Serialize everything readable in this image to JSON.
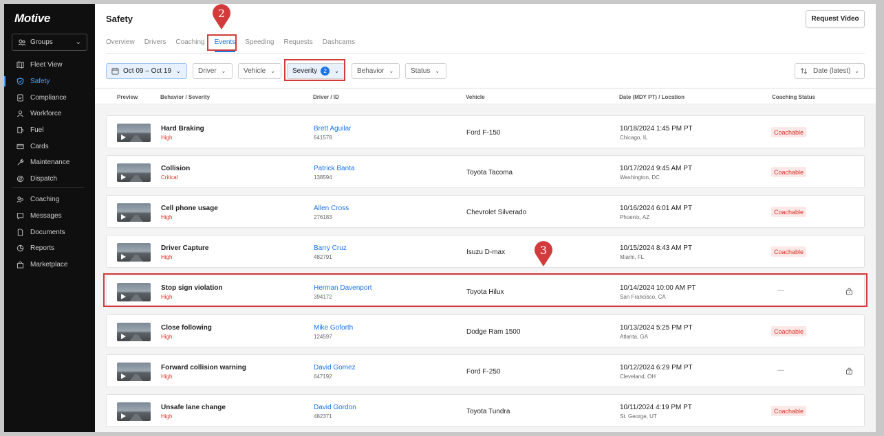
{
  "app": {
    "logo": "Motive",
    "groups_label": "Groups"
  },
  "nav": [
    {
      "label": "Fleet View",
      "icon": "map-icon"
    },
    {
      "label": "Safety",
      "icon": "shield-icon",
      "active": true
    },
    {
      "label": "Compliance",
      "icon": "compliance-icon"
    },
    {
      "label": "Workforce",
      "icon": "workforce-icon"
    },
    {
      "label": "Fuel",
      "icon": "fuel-icon"
    },
    {
      "label": "Cards",
      "icon": "card-icon"
    },
    {
      "label": "Maintenance",
      "icon": "wrench-icon"
    },
    {
      "label": "Dispatch",
      "icon": "dispatch-icon"
    },
    {
      "label": "Coaching",
      "icon": "coaching-icon"
    },
    {
      "label": "Messages",
      "icon": "message-icon"
    },
    {
      "label": "Documents",
      "icon": "document-icon"
    },
    {
      "label": "Reports",
      "icon": "report-icon"
    },
    {
      "label": "Marketplace",
      "icon": "bag-icon"
    }
  ],
  "header": {
    "title": "Safety",
    "request_video": "Request Video"
  },
  "tabs": [
    "Overview",
    "Drivers",
    "Coaching",
    "Events",
    "Speeding",
    "Requests",
    "Dashcams"
  ],
  "active_tab": "Events",
  "filters": {
    "date": "Oct 09 – Oct 19",
    "driver": "Driver",
    "vehicle": "Vehicle",
    "severity": "Severity",
    "severity_count": "2",
    "behavior": "Behavior",
    "status": "Status",
    "sort": "Date (latest)"
  },
  "columns": [
    "Preview",
    "Behavior / Severity",
    "Driver / ID",
    "Vehicle",
    "Date (MDY PT) / Location",
    "Coaching Status"
  ],
  "rows": [
    {
      "behavior": "Hard Braking",
      "severity": "High",
      "driver": "Brett Aguilar",
      "id": "641578",
      "vehicle": "Ford F-150",
      "date": "10/18/2024 1:45 PM PT",
      "location": "Chicago, IL",
      "status": "Coachable"
    },
    {
      "behavior": "Collision",
      "severity": "Critical",
      "driver": "Patrick Banta",
      "id": "138594",
      "vehicle": "Toyota Tacoma",
      "date": "10/17/2024 9:45 AM PT",
      "location": "Washington, DC",
      "status": "Coachable"
    },
    {
      "behavior": "Cell phone usage",
      "severity": "High",
      "driver": "Allen Cross",
      "id": "276183",
      "vehicle": "Chevrolet Silverado",
      "date": "10/16/2024 6:01 AM PT",
      "location": "Phoenix, AZ",
      "status": "Coachable"
    },
    {
      "behavior": "Driver Capture",
      "severity": "High",
      "driver": "Barry Cruz",
      "id": "482791",
      "vehicle": "Isuzu D-max",
      "date": "10/15/2024 8:43 AM PT",
      "location": "Miami, FL",
      "status": "Coachable"
    },
    {
      "behavior": "Stop sign violation",
      "severity": "High",
      "driver": "Herman Davenport",
      "id": "394172",
      "vehicle": "Toyota Hilux",
      "date": "10/14/2024 10:00 AM PT",
      "location": "San Francisco, CA",
      "status": "—",
      "locked": true
    },
    {
      "behavior": "Close following",
      "severity": "High",
      "driver": "Mike Goforth",
      "id": "124597",
      "vehicle": "Dodge Ram 1500",
      "date": "10/13/2024 5:25 PM PT",
      "location": "Atlanta, GA",
      "status": "Coachable"
    },
    {
      "behavior": "Forward collision warning",
      "severity": "High",
      "driver": "David Gomez",
      "id": "647192",
      "vehicle": "Ford F-250",
      "date": "10/12/2024 6:29 PM PT",
      "location": "Cleveland, OH",
      "status": "—",
      "locked": true
    },
    {
      "behavior": "Unsafe lane change",
      "severity": "High",
      "driver": "David Gordon",
      "id": "482371",
      "vehicle": "Toyota Tundra",
      "date": "10/11/2024 4:19 PM PT",
      "location": "St. George, UT",
      "status": "Coachable"
    }
  ],
  "annotations": {
    "step2": "2",
    "step3": "3",
    "color": "#d23b3b"
  },
  "colors": {
    "accent": "#1a73e8",
    "danger": "#d93025",
    "sidebar": "#0f0f10"
  }
}
